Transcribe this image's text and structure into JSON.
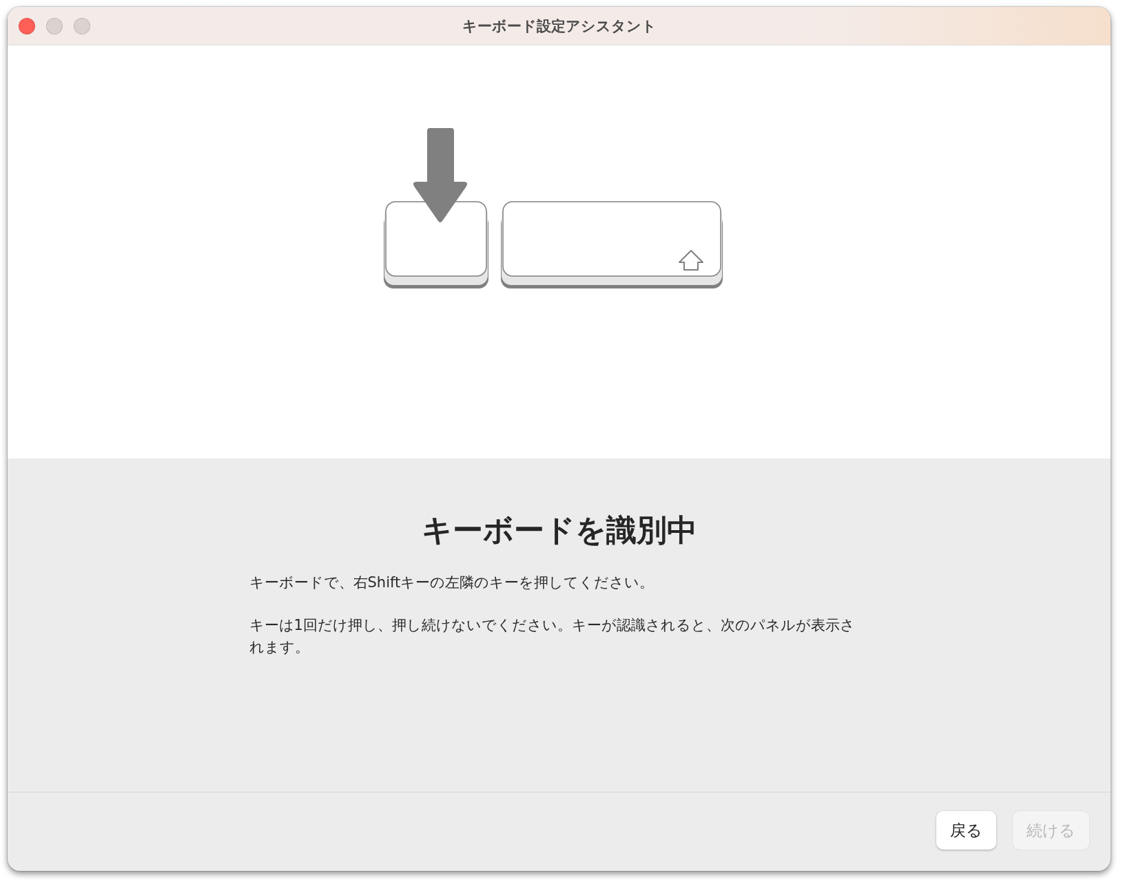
{
  "window": {
    "title": "キーボード設定アシスタント"
  },
  "heading": "キーボードを識別中",
  "paragraphs": [
    "キーボードで、右Shiftキーの左隣のキーを押してください。",
    "キーは1回だけ押し、押し続けないでください。キーが認識されると、次のパネルが表示されます。"
  ],
  "buttons": [
    {
      "label": "戻る",
      "disabled": false
    },
    {
      "label": "続ける",
      "disabled": true
    }
  ]
}
